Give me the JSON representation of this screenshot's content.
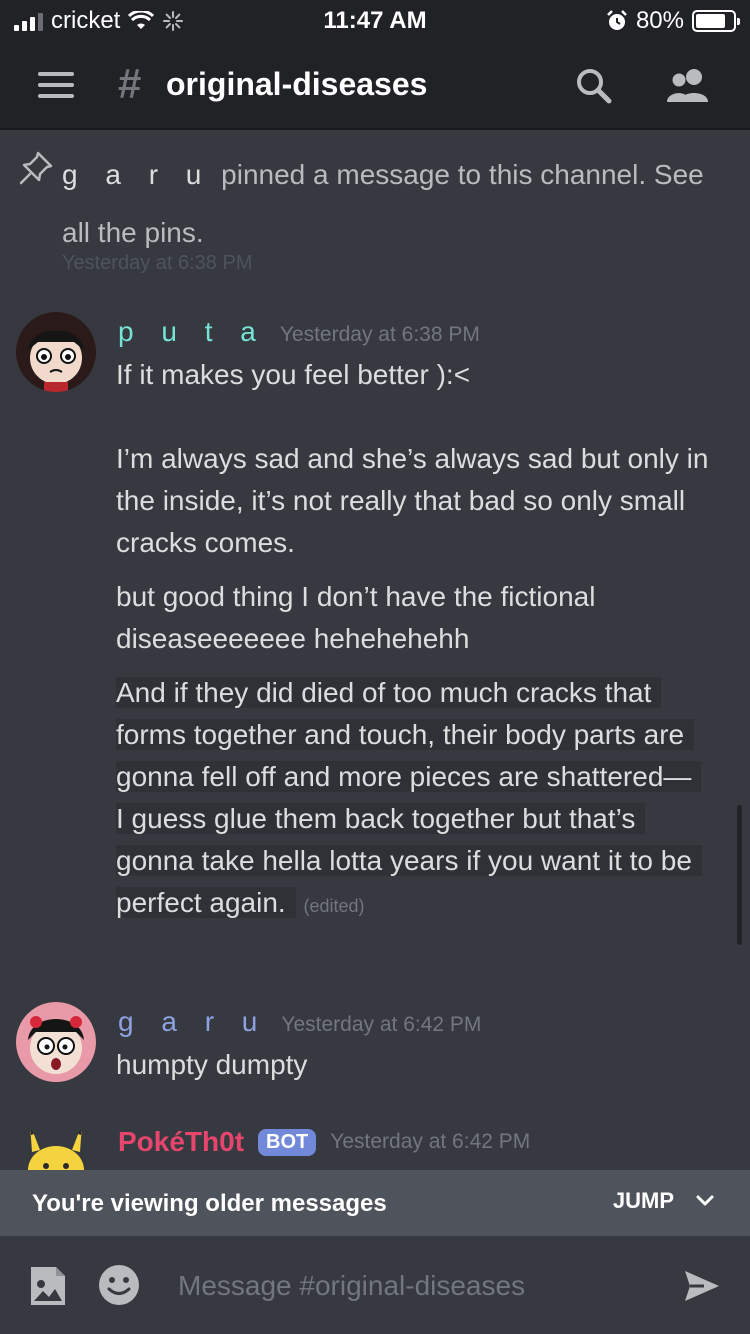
{
  "status_bar": {
    "carrier": "cricket",
    "time": "11:47 AM",
    "battery": "80%",
    "battery_level": 0.8
  },
  "header": {
    "hash": "#",
    "channel": "original-diseases"
  },
  "system_message": {
    "user": "g a r u",
    "text": "pinned a message to this channel. See all the pins.",
    "time": "Yesterday at 6:38 PM"
  },
  "messages": [
    {
      "user": "p u t a",
      "user_color": "#76e4d5",
      "time": "Yesterday at 6:38 PM",
      "lines": [
        "If it makes you feel better ):<",
        "I’m always sad and she’s always sad but only in the inside, it’s not really that bad so only small cracks comes.",
        "but good thing I don’t have the fictional diseaseeeeeee hehehehehh"
      ],
      "highlighted_a": "And if they did died of too much cracks that forms together and touch, their body parts are gonna fell off and more pieces are shattered—",
      "highlighted_b": "I guess glue them back together but that’s gonna take hella lotta years if you want it to be perfect again.",
      "edited": "(edited)"
    },
    {
      "user": "g a r u",
      "user_color": "#8ea1e1",
      "time": "Yesterday at 6:42 PM",
      "lines": [
        "humpty dumpty"
      ]
    },
    {
      "user": "PokéTh0t",
      "user_color": "#e6466e",
      "badge": "BOT",
      "time": "Yesterday at 6:42 PM"
    }
  ],
  "older_bar": {
    "text": "You're viewing older messages",
    "jump": "JUMP"
  },
  "composer": {
    "placeholder": "Message #original-diseases"
  }
}
